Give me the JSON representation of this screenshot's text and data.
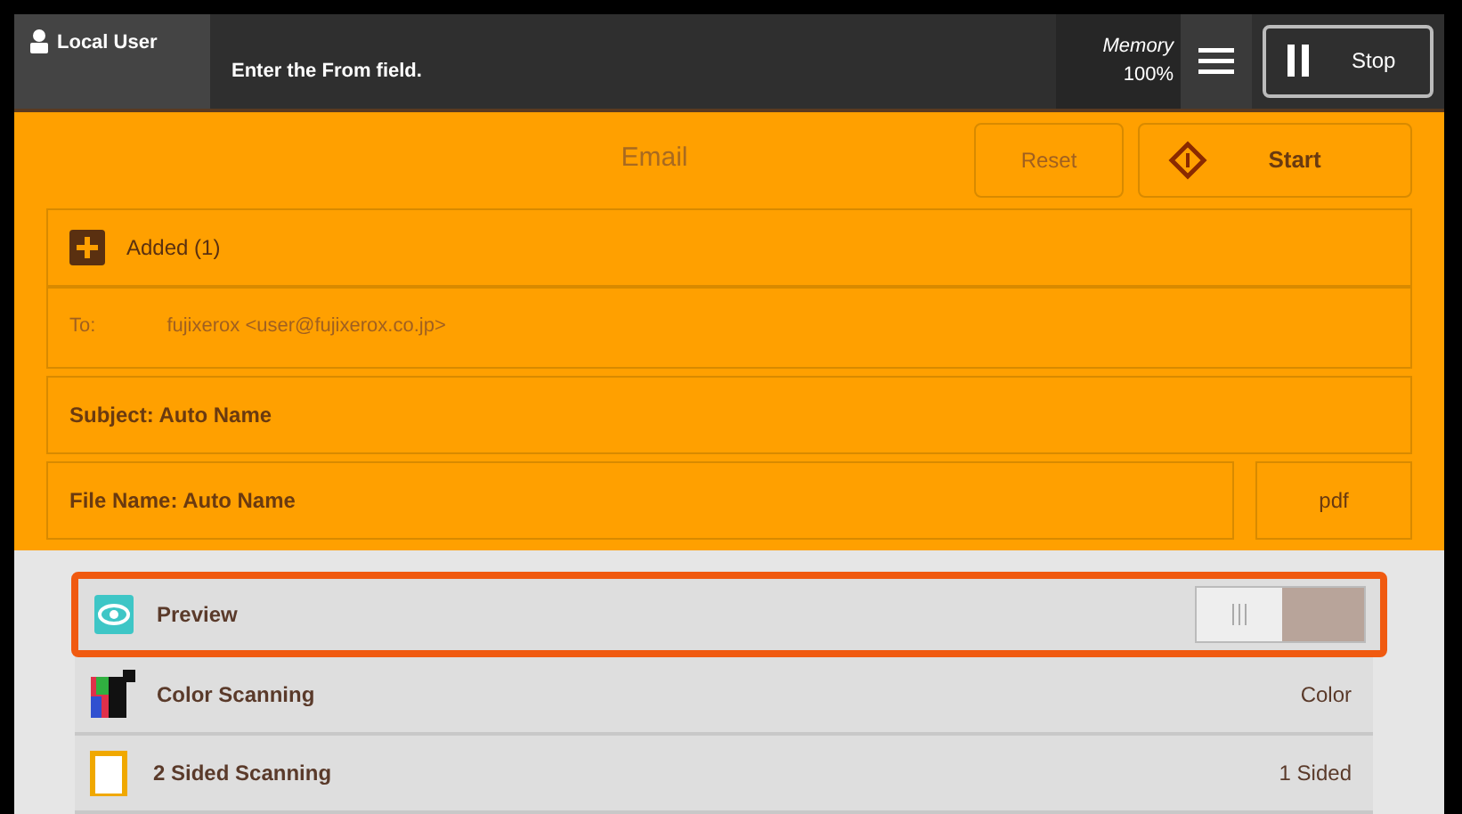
{
  "header": {
    "user": "Local User",
    "message": "Enter the From field.",
    "memory_label": "Memory",
    "memory_value": "100%",
    "stop": "Stop"
  },
  "job": {
    "title": "Email",
    "reset": "Reset",
    "start": "Start"
  },
  "recipients": {
    "added": "Added (1)",
    "to_label": "To:",
    "to_value": "fujixerox <user@fujixerox.co.jp>"
  },
  "subject": "Subject: Auto Name",
  "file_name": "File Name: Auto Name",
  "file_type": "pdf",
  "features": [
    {
      "kind": "toggle",
      "label": "Preview",
      "on": false,
      "highlighted": true
    },
    {
      "kind": "value",
      "label": "Color Scanning",
      "value": "Color",
      "highlighted": false
    },
    {
      "kind": "value",
      "label": "2 Sided Scanning",
      "value": "1 Sided",
      "highlighted": false
    }
  ]
}
